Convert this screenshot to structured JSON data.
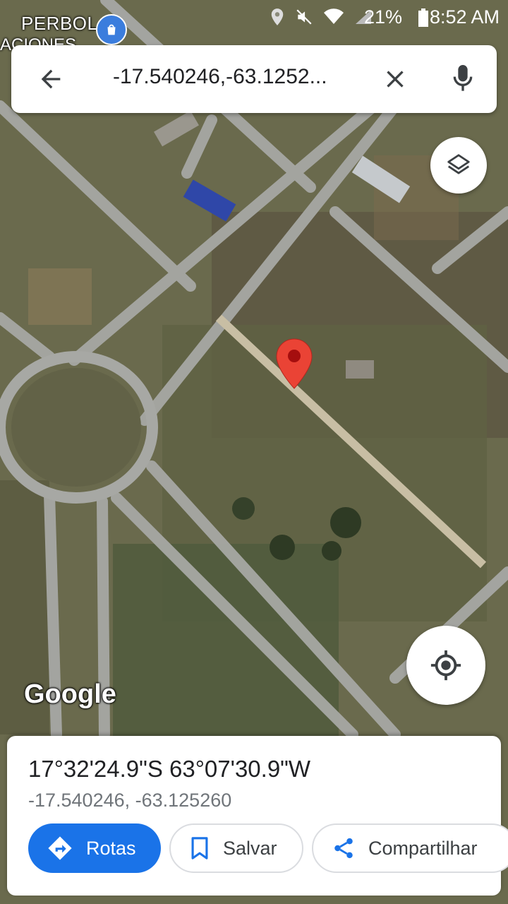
{
  "status_bar": {
    "time": "8:52 AM",
    "battery": "21%",
    "icons": [
      "location-icon",
      "mute-icon",
      "wifi-icon",
      "signal-icon",
      "battery-icon"
    ]
  },
  "map": {
    "label_primary": "PERBOL",
    "label_secondary": "ACIONES",
    "attribution": "Google"
  },
  "search": {
    "query": "-17.540246,-63.1252..."
  },
  "place": {
    "coordinates_dms": "17°32'24.9\"S 63°07'30.9\"W",
    "coordinates_decimal": "-17.540246, -63.125260"
  },
  "actions": {
    "directions_label": "Rotas",
    "save_label": "Salvar",
    "share_label": "Compartilhar"
  },
  "colors": {
    "accent": "#1a73e8",
    "marker": "#ea4335"
  }
}
